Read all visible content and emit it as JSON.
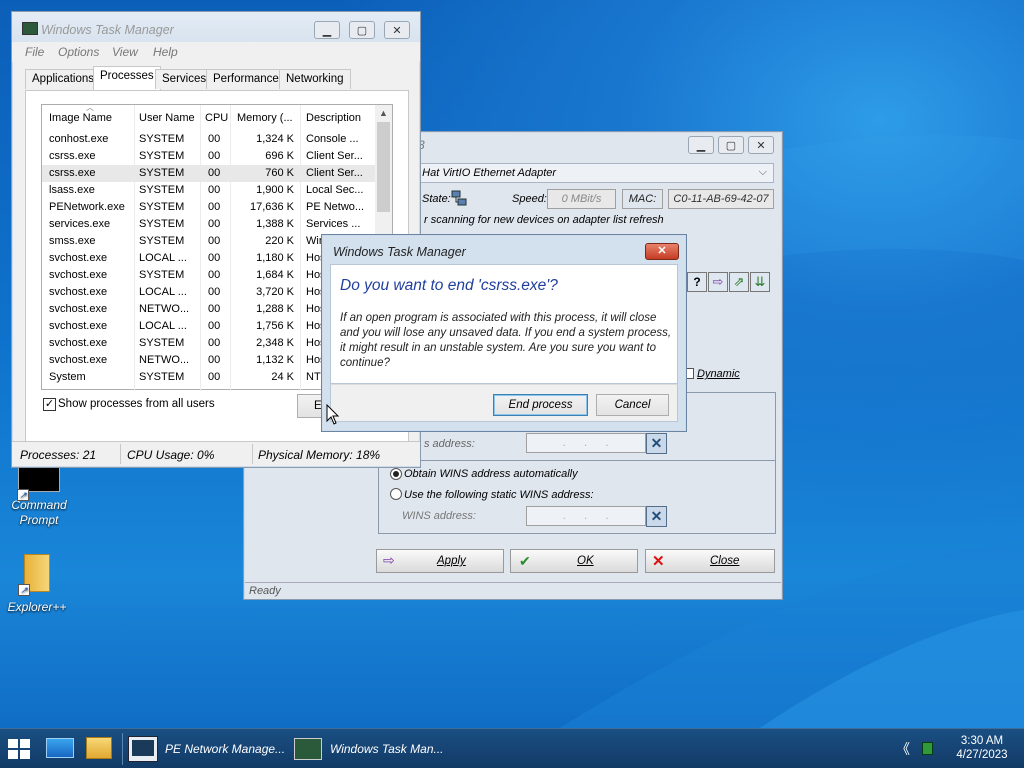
{
  "desktop": {
    "icons": [
      {
        "label": "Command Prompt"
      },
      {
        "label": "Explorer++"
      }
    ]
  },
  "task_manager": {
    "title": "Windows Task Manager",
    "menu": [
      "File",
      "Options",
      "View",
      "Help"
    ],
    "tabs": [
      "Applications",
      "Processes",
      "Services",
      "Performance",
      "Networking"
    ],
    "active_tab": "Processes",
    "columns": [
      "Image Name",
      "User Name",
      "CPU",
      "Memory (...",
      "Description"
    ],
    "rows": [
      [
        "conhost.exe",
        "SYSTEM",
        "00",
        "1,324 K",
        "Console ..."
      ],
      [
        "csrss.exe",
        "SYSTEM",
        "00",
        "696 K",
        "Client Ser..."
      ],
      [
        "csrss.exe",
        "SYSTEM",
        "00",
        "760 K",
        "Client Ser..."
      ],
      [
        "lsass.exe",
        "SYSTEM",
        "00",
        "1,900 K",
        "Local Sec..."
      ],
      [
        "PENetwork.exe",
        "SYSTEM",
        "00",
        "17,636 K",
        "PE Netwo..."
      ],
      [
        "services.exe",
        "SYSTEM",
        "00",
        "1,388 K",
        "Services ..."
      ],
      [
        "smss.exe",
        "SYSTEM",
        "00",
        "220 K",
        "Win"
      ],
      [
        "svchost.exe",
        "LOCAL ...",
        "00",
        "1,180 K",
        "Hos"
      ],
      [
        "svchost.exe",
        "SYSTEM",
        "00",
        "1,684 K",
        "Hos"
      ],
      [
        "svchost.exe",
        "LOCAL ...",
        "00",
        "3,720 K",
        "Hos"
      ],
      [
        "svchost.exe",
        "NETWO...",
        "00",
        "1,288 K",
        "Hos"
      ],
      [
        "svchost.exe",
        "LOCAL ...",
        "00",
        "1,756 K",
        "Hos"
      ],
      [
        "svchost.exe",
        "SYSTEM",
        "00",
        "2,348 K",
        "Hos"
      ],
      [
        "svchost.exe",
        "NETWO...",
        "00",
        "1,132 K",
        "Hos"
      ],
      [
        "System",
        "SYSTEM",
        "00",
        "24 K",
        "NT"
      ]
    ],
    "selected_row_index": 2,
    "show_all_label": "Show processes from all users",
    "end_button_partial": "E",
    "status": {
      "processes": "Processes: 21",
      "cpu": "CPU Usage: 0%",
      "memory": "Physical Memory: 18%"
    }
  },
  "pe_network": {
    "title_partial": "3",
    "adapter": "d Hat VirtIO Ethernet Adapter",
    "state_label": "State:",
    "speed_label": "Speed:",
    "speed_value": "0 MBit/s",
    "mac_label": "MAC:",
    "mac_value": "C0-11-AB-69-42-07",
    "scan_text": "r scanning for new devices on adapter list refresh",
    "dynamic_label": "Dynamic",
    "s_address_label": "s address:",
    "wins_auto": "Obtain WINS address automatically",
    "wins_static": "Use the following static WINS address:",
    "wins_address_label": "WINS address:",
    "buttons": {
      "apply": "Apply",
      "ok": "OK",
      "close": "Close"
    },
    "status": "Ready"
  },
  "dialog": {
    "title": "Windows Task Manager",
    "heading": "Do you want to end 'csrss.exe'?",
    "message": "If an open program is associated with this process, it will close and you will lose any unsaved data. If you end a system process, it might result in an unstable system. Are you sure you want to continue?",
    "end_button": "End process",
    "cancel_button": "Cancel"
  },
  "taskbar": {
    "items": [
      "PE Network Manage...",
      "Windows Task Man..."
    ],
    "time": "3:30 AM",
    "date": "4/27/2023"
  }
}
